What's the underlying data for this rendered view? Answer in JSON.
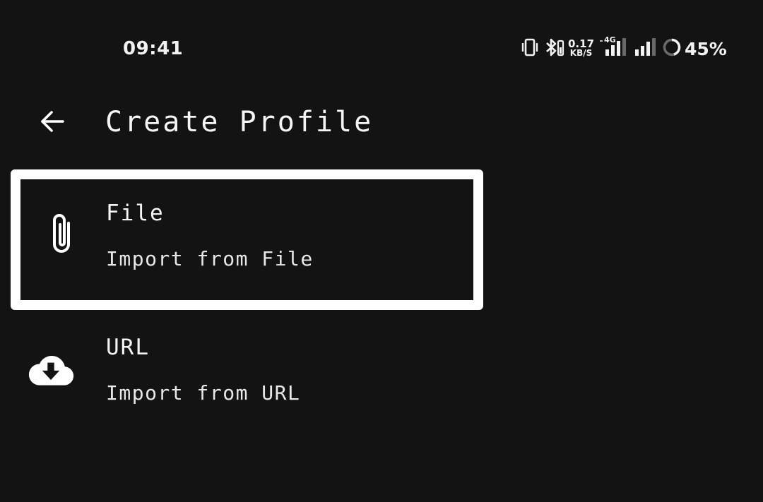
{
  "status_bar": {
    "time": "09:41",
    "net_speed_value": "0.17",
    "net_speed_unit": "KB/S",
    "network_type": "4G",
    "battery_percent": "45%",
    "battery_level": 0.45,
    "icons": [
      "vibrate-icon",
      "bluetooth-icon",
      "signal-4g-icon",
      "signal-icon",
      "battery-ring-icon"
    ]
  },
  "app_bar": {
    "back_icon": "arrow-left-icon",
    "title": "Create Profile"
  },
  "items": [
    {
      "icon": "paperclip-icon",
      "title": "File",
      "subtitle": "Import from File",
      "selected": true
    },
    {
      "icon": "cloud-download-icon",
      "title": "URL",
      "subtitle": "Import from URL",
      "selected": false
    }
  ],
  "colors": {
    "background": "#131313",
    "foreground": "#ffffff",
    "selection_border": "#ffffff",
    "battery_track": "#6a6a6a"
  }
}
